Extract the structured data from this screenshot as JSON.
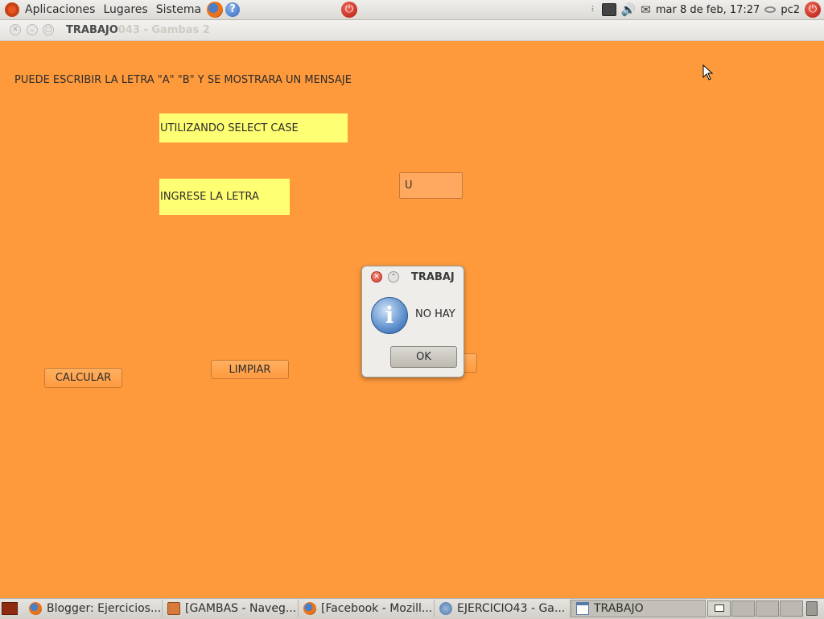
{
  "top_panel": {
    "menus": [
      "Aplicaciones",
      "Lugares",
      "Sistema"
    ],
    "datetime": "mar  8 de feb, 17:27",
    "user": "pc2"
  },
  "window": {
    "title": "TRABAJO",
    "title_ghost": "043 - Gambas 2"
  },
  "form": {
    "instruction": "PUEDE ESCRIBIR LA LETRA \"A\" \"B\" Y SE MOSTRARA UN MENSAJE",
    "label_select": "UTILIZANDO SELECT CASE",
    "label_ingrese": "INGRESE LA LETRA",
    "letter_value": "U",
    "calcular_label": "CALCULAR",
    "limpiar_label": "LIMPIAR"
  },
  "dialog": {
    "title": "TRABAJ",
    "message": "NO HAY",
    "ok_label": "OK"
  },
  "taskbar": {
    "tasks": [
      {
        "label": "Blogger: Ejercicios...",
        "icon": "firefox-icon"
      },
      {
        "label": "[GAMBAS - Naveg...",
        "icon": "gambas-icon"
      },
      {
        "label": "[Facebook - Mozill...",
        "icon": "firefox-icon"
      },
      {
        "label": "EJERCICIO43 - Ga...",
        "icon": "gambas-ide-icon"
      },
      {
        "label": "TRABAJO",
        "icon": "window-icon"
      }
    ]
  },
  "colors": {
    "window_bg": "#ff9a3c",
    "label_bg": "#ffff73"
  }
}
